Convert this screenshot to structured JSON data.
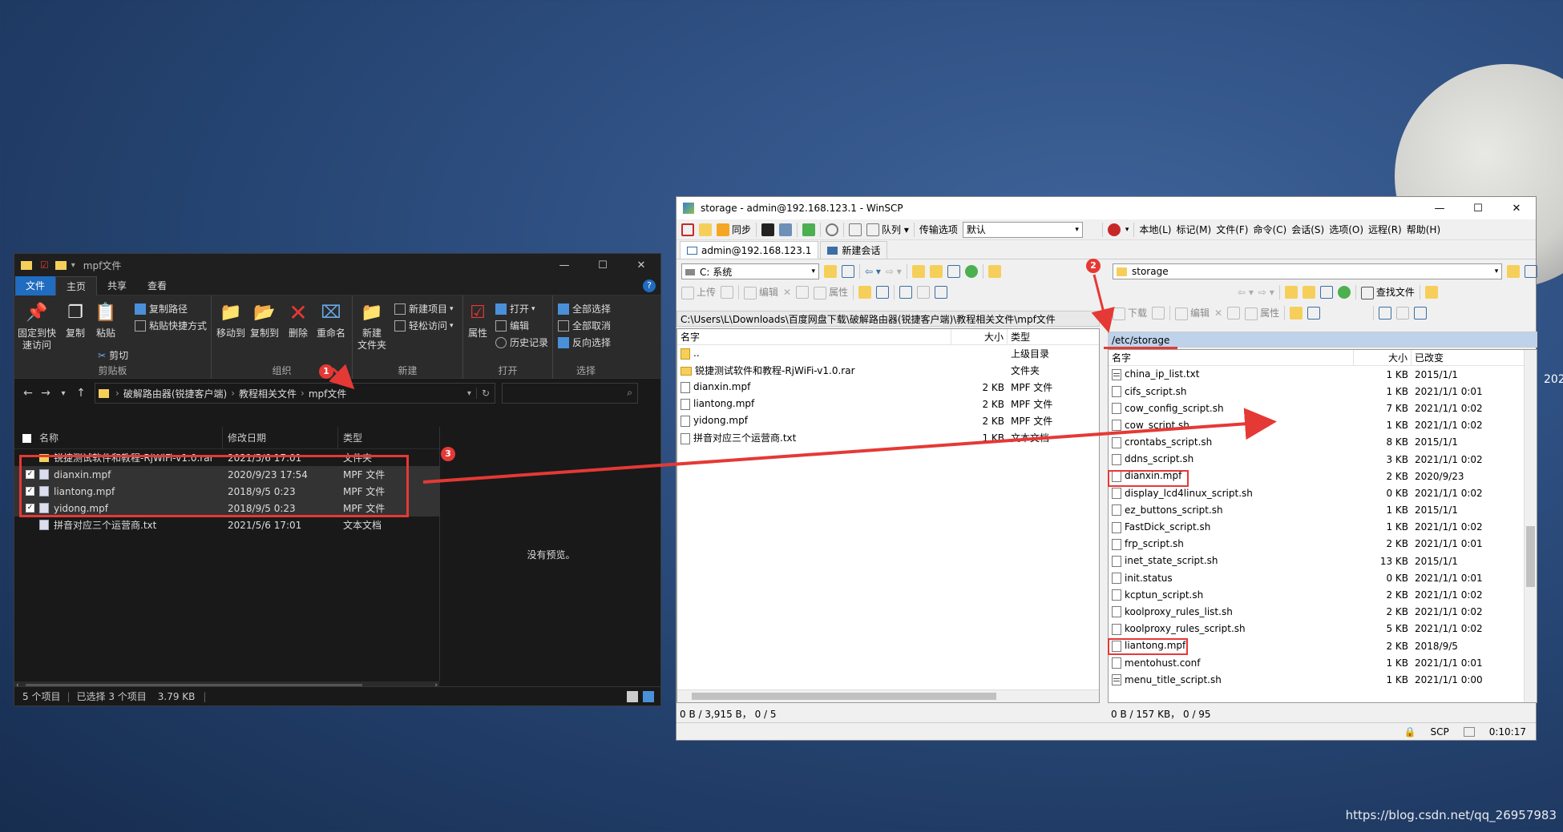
{
  "desktop": {
    "clock_fragment": "202",
    "watermark": "https://blog.csdn.net/qq_26957983"
  },
  "explorer": {
    "title": "mpf文件",
    "menu": [
      "文件",
      "主页",
      "共享",
      "查看"
    ],
    "ribbon": {
      "clipboard": {
        "pin": "固定到快\n速访问",
        "copy": "复制",
        "paste": "粘贴",
        "copy_path": "复制路径",
        "paste_shortcut": "粘贴快捷方式",
        "cut": "剪切",
        "label": "剪贴板"
      },
      "organize": {
        "move_to": "移动到",
        "copy_to": "复制到",
        "delete": "删除",
        "rename": "重命名",
        "label": "组织"
      },
      "new": {
        "new_folder": "新建\n文件夹",
        "new_item": "新建项目",
        "easy_access": "轻松访问",
        "label": "新建"
      },
      "open": {
        "properties": "属性",
        "open": "打开",
        "edit": "编辑",
        "history": "历史记录",
        "label": "打开"
      },
      "select": {
        "select_all": "全部选择",
        "select_none": "全部取消",
        "invert": "反向选择",
        "label": "选择"
      }
    },
    "breadcrumbs": [
      "破解路由器(锐捷客户端)",
      "教程相关文件",
      "mpf文件"
    ],
    "columns": [
      "名称",
      "修改日期",
      "类型"
    ],
    "files": [
      {
        "name": "锐捷测试软件和教程-RjWiFi-v1.0.rar",
        "date": "2021/5/6 17:01",
        "type": "文件夹",
        "checked": false,
        "selected": false
      },
      {
        "name": "dianxin.mpf",
        "date": "2020/9/23 17:54",
        "type": "MPF 文件",
        "checked": true,
        "selected": true
      },
      {
        "name": "liantong.mpf",
        "date": "2018/9/5 0:23",
        "type": "MPF 文件",
        "checked": true,
        "selected": true
      },
      {
        "name": "yidong.mpf",
        "date": "2018/9/5 0:23",
        "type": "MPF 文件",
        "checked": true,
        "selected": true
      },
      {
        "name": "拼音对应三个运营商.txt",
        "date": "2021/5/6 17:01",
        "type": "文本文档",
        "checked": false,
        "selected": false
      }
    ],
    "preview_text": "没有预览。",
    "status": {
      "count": "5 个项目",
      "selected": "已选择 3 个项目",
      "size": "3.79 KB"
    }
  },
  "winscp": {
    "title": "storage - admin@192.168.123.1 - WinSCP",
    "toolbar1": {
      "sync": "同步",
      "queue": "队列",
      "transfer_options": "传输选项",
      "transfer_default": "默认"
    },
    "menu": [
      "本地(L)",
      "标记(M)",
      "文件(F)",
      "命令(C)",
      "会话(S)",
      "选项(O)",
      "远程(R)",
      "帮助(H)"
    ],
    "tabs": [
      "admin@192.168.123.1",
      "新建会话"
    ],
    "local": {
      "drive": "C: 系统",
      "actions": [
        "上传",
        "编辑",
        "属性"
      ],
      "path": "C:\\Users\\L\\Downloads\\百度网盘下载\\破解路由器(锐捷客户端)\\教程相关文件\\mpf文件",
      "columns": [
        "名字",
        "大小",
        "类型"
      ],
      "files": [
        {
          "name": "..",
          "size": "",
          "type": "上级目录",
          "icon": "up"
        },
        {
          "name": "锐捷测试软件和教程-RjWiFi-v1.0.rar",
          "size": "",
          "type": "文件夹",
          "icon": "folder"
        },
        {
          "name": "dianxin.mpf",
          "size": "2 KB",
          "type": "MPF 文件",
          "icon": "file"
        },
        {
          "name": "liantong.mpf",
          "size": "2 KB",
          "type": "MPF 文件",
          "icon": "file"
        },
        {
          "name": "yidong.mpf",
          "size": "2 KB",
          "type": "MPF 文件",
          "icon": "file"
        },
        {
          "name": "拼音对应三个运营商.txt",
          "size": "1 KB",
          "type": "文本文档",
          "icon": "file"
        }
      ],
      "status": "0 B / 3,915 B，  0 / 5"
    },
    "remote": {
      "dir": "storage",
      "actions": [
        "下载",
        "编辑",
        "属性",
        "查找文件"
      ],
      "path": "/etc/storage",
      "columns": [
        "名字",
        "大小",
        "已改变"
      ],
      "files": [
        {
          "name": "china_ip_list.txt",
          "size": "1 KB",
          "changed": "2015/1/1",
          "icon": "script"
        },
        {
          "name": "cifs_script.sh",
          "size": "1 KB",
          "changed": "2021/1/1 0:01",
          "icon": "file"
        },
        {
          "name": "cow_config_script.sh",
          "size": "7 KB",
          "changed": "2021/1/1 0:02",
          "icon": "file"
        },
        {
          "name": "cow_script.sh",
          "size": "1 KB",
          "changed": "2021/1/1 0:02",
          "icon": "file"
        },
        {
          "name": "crontabs_script.sh",
          "size": "8 KB",
          "changed": "2015/1/1",
          "icon": "file"
        },
        {
          "name": "ddns_script.sh",
          "size": "3 KB",
          "changed": "2021/1/1 0:02",
          "icon": "file"
        },
        {
          "name": "dianxin.mpf",
          "size": "2 KB",
          "changed": "2020/9/23",
          "icon": "file",
          "boxed": true
        },
        {
          "name": "display_lcd4linux_script.sh",
          "size": "0 KB",
          "changed": "2021/1/1 0:02",
          "icon": "file"
        },
        {
          "name": "ez_buttons_script.sh",
          "size": "1 KB",
          "changed": "2015/1/1",
          "icon": "file"
        },
        {
          "name": "FastDick_script.sh",
          "size": "1 KB",
          "changed": "2021/1/1 0:02",
          "icon": "file"
        },
        {
          "name": "frp_script.sh",
          "size": "2 KB",
          "changed": "2021/1/1 0:01",
          "icon": "file"
        },
        {
          "name": "inet_state_script.sh",
          "size": "13 KB",
          "changed": "2015/1/1",
          "icon": "file"
        },
        {
          "name": "init.status",
          "size": "0 KB",
          "changed": "2021/1/1 0:01",
          "icon": "file"
        },
        {
          "name": "kcptun_script.sh",
          "size": "2 KB",
          "changed": "2021/1/1 0:02",
          "icon": "file"
        },
        {
          "name": "koolproxy_rules_list.sh",
          "size": "2 KB",
          "changed": "2021/1/1 0:02",
          "icon": "file"
        },
        {
          "name": "koolproxy_rules_script.sh",
          "size": "5 KB",
          "changed": "2021/1/1 0:02",
          "icon": "file"
        },
        {
          "name": "liantong.mpf",
          "size": "2 KB",
          "changed": "2018/9/5",
          "icon": "file",
          "boxed": true
        },
        {
          "name": "mentohust.conf",
          "size": "1 KB",
          "changed": "2021/1/1 0:01",
          "icon": "file"
        },
        {
          "name": "menu_title_script.sh",
          "size": "1 KB",
          "changed": "2021/1/1 0:00",
          "icon": "script"
        }
      ],
      "status": "0 B / 157 KB，  0 / 95"
    },
    "bottom": {
      "protocol": "SCP",
      "time": "0:10:17"
    }
  },
  "annotations": {
    "badges": [
      "1",
      "2",
      "3"
    ],
    "color": "#e53935"
  }
}
